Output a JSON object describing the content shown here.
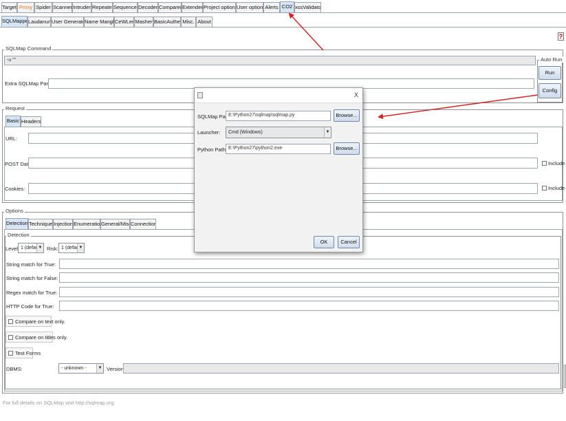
{
  "top_tabs": [
    {
      "label": "Target"
    },
    {
      "label": "Proxy"
    },
    {
      "label": "Spider"
    },
    {
      "label": "Scanner"
    },
    {
      "label": "Intruder"
    },
    {
      "label": "Repeater"
    },
    {
      "label": "Sequencer"
    },
    {
      "label": "Decoder"
    },
    {
      "label": "Comparer"
    },
    {
      "label": "Extender"
    },
    {
      "label": "Project options"
    },
    {
      "label": "User options"
    },
    {
      "label": "Alerts"
    },
    {
      "label": "CO2"
    },
    {
      "label": "xssValidator"
    }
  ],
  "sub_tabs": [
    {
      "label": "SQLMapper"
    },
    {
      "label": "Laudanum"
    },
    {
      "label": "User Generator"
    },
    {
      "label": "Name Mangler"
    },
    {
      "label": "CeWLer"
    },
    {
      "label": "Masher"
    },
    {
      "label": "BasicAuther"
    },
    {
      "label": "Misc."
    },
    {
      "label": "About"
    }
  ],
  "help_label": "?",
  "sqlmap_command": {
    "title": "SQLMap Command",
    "command_text": "-u \"\"",
    "extra_label": "Extra SQLMap Params:",
    "extra_value": "",
    "auto_run_label": "Auto Run",
    "run_label": "Run",
    "config_label": "Config"
  },
  "request": {
    "title": "Request",
    "tabs": [
      {
        "label": "Basic"
      },
      {
        "label": "Headers"
      }
    ],
    "url_label": "URL:",
    "url_value": "",
    "post_label": "POST Data:",
    "post_value": "",
    "cookies_label": "Cookies:",
    "cookies_value": "",
    "include_label": "Include"
  },
  "options": {
    "title": "Options",
    "tabs": [
      {
        "label": "Detection"
      },
      {
        "label": "Techniques"
      },
      {
        "label": "Injection"
      },
      {
        "label": "Enumeration"
      },
      {
        "label": "General/Misc."
      },
      {
        "label": "Connection"
      }
    ],
    "detection": {
      "title": "Detection",
      "level_label": "Level:",
      "level_value": "1 (default)",
      "risk_label": "Risk:",
      "risk_value": "1 (default)",
      "string_true_label": "String match for True:",
      "string_false_label": "String match for False:",
      "regex_true_label": "Regex match for True:",
      "http_code_label": "HTTP Code for True:",
      "compare_text_label": "Compare on text only.",
      "compare_titles_label": "Compare on titles only.",
      "test_forms_label": "Test Forms",
      "dbms_label": "DBMS:",
      "dbms_value": "- unknown -",
      "version_label": "Version:",
      "version_value": ""
    }
  },
  "footer_text": "For full details on SQLMap visit http://sqlmap.org",
  "dialog": {
    "close_label": "X",
    "sqlmap_path_label": "SQLMap Path:",
    "sqlmap_path_value": "E:\\Python27\\sqlmap\\sqlmap.py",
    "browse_label": "Browse...",
    "launcher_label": "Launcher:",
    "launcher_value": "Cmd (Windows)",
    "python_path_label": "Python Path:",
    "python_path_value": "E:\\Python27\\python2.exe",
    "ok_label": "OK",
    "cancel_label": "Cancel"
  },
  "colors": {
    "accent_arrow": "#d42020",
    "active_tab": "#d6e6f6",
    "proxy_tab_text": "#e8770e",
    "button_border": "#6f88a6"
  }
}
